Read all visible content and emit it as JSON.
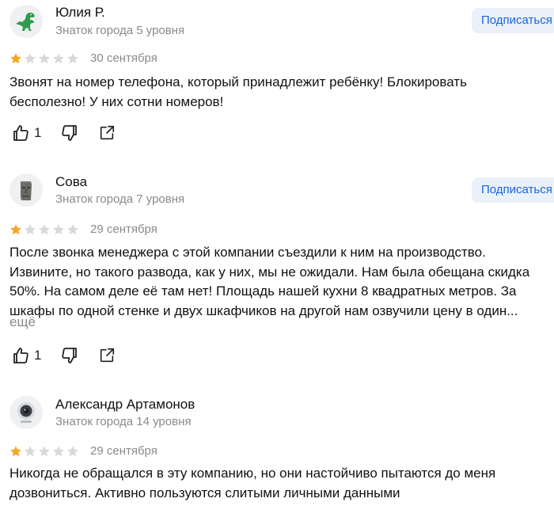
{
  "reviews": [
    {
      "author": "Юлия Р.",
      "level": "Знаток города 5 уровня",
      "subscribe": "Подписаться",
      "rating": 1,
      "date": "30 сентября",
      "text": "Звонят на номер телефона, который принадлежит ребёнку! Блокировать бесполезно! У них сотни номеров!",
      "likes": "1",
      "avatar_icon": "dinosaur-icon"
    },
    {
      "author": "Сова",
      "level": "Знаток города 7 уровня",
      "subscribe": "Подписаться",
      "rating": 1,
      "date": "29 сентября",
      "text": "После звонка менеджера с этой компании съездили к ним на производство. Извините, но такого развода, как у них, мы не ожидали. Нам была обещана скидка 50%. На самом деле её там нет! Площадь нашей кухни 8 квадратных метров. За шкафы по одной стенке и двух шкафчиков на другой нам озвучили цену в один...",
      "more": "ещё",
      "likes": "1",
      "avatar_icon": "moai-statue-icon"
    },
    {
      "author": "Александр Артамонов",
      "level": "Знаток города 14 уровня",
      "rating": 1,
      "date": "29 сентября",
      "text": "Никогда не обращался в эту компанию, но они настойчиво пытаются до меня дозвониться. Активно пользуются слитыми личными данными",
      "avatar_icon": "webcam-icon"
    }
  ],
  "colors": {
    "star_filled": "#f5a623",
    "star_empty": "#d9d9d9",
    "subscribe_bg": "#eaf1fb",
    "subscribe_text": "#1b63d9",
    "muted": "#8a8a8a"
  }
}
